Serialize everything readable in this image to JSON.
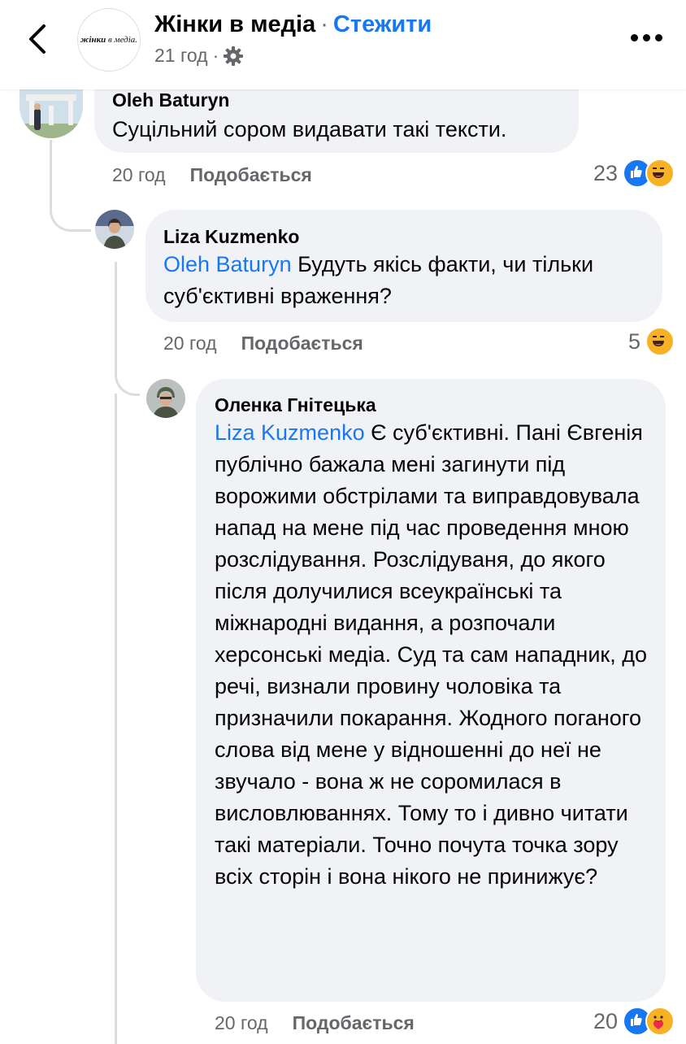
{
  "header": {
    "page_name": "Жінки в медіа",
    "separator": "·",
    "follow_label": "Стежити",
    "time": "21 год",
    "logo_word1": "жінки",
    "logo_word2": "в медіа."
  },
  "comments": [
    {
      "author": "Oleh Baturyn",
      "text": "Суцільний сором видавати такі тексти.",
      "time": "20 год",
      "like_label": "Подобається",
      "reaction_count": "23",
      "reactions": [
        "like-icon",
        "haha-icon"
      ]
    },
    {
      "author": "Liza Kuzmenko",
      "mention": "Oleh Baturyn",
      "text": " Будуть якісь факти, чи тільки суб'єктивні враження?",
      "time": "20 год",
      "like_label": "Подобається",
      "reaction_count": "5",
      "reactions": [
        "haha-icon"
      ]
    },
    {
      "author": "Оленка Гнітецька",
      "mention": "Liza Kuzmenko",
      "text": " Є суб'єктивні. Пані Євгенія публічно бажала мені загинути під ворожими обстрілами та виправдовувала напад на мене під час проведення мною розслідування. Розслідуваня, до якого після долучилися всеукраїнські та міжнародні видання, а розпочали херсонські медіа. Суд та сам нападник, до речі, визнали провину чоловіка та призначили покарання. Жодного поганого слова від мене у відношенні до неї не звучало - вона ж не соромилася в висловлюваннях. Тому то і дивно читати такі матеріали. Точно почута точка зору всіх сторін і вона нікого не принижує?",
      "time": "20 год",
      "like_label": "Подобається",
      "reaction_count": "20",
      "reactions": [
        "like-icon",
        "care-icon"
      ]
    }
  ],
  "colors": {
    "link": "#1877f2",
    "bubble": "#f0f2f5",
    "meta": "#65676b"
  }
}
